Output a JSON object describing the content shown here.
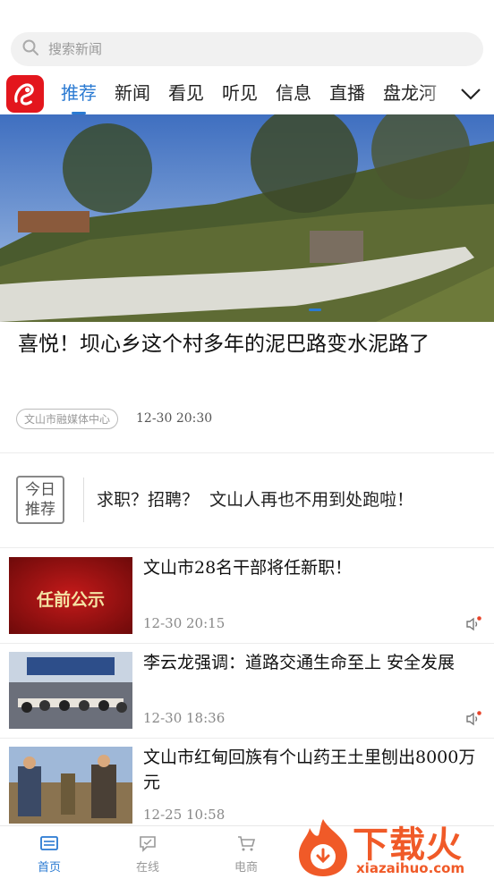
{
  "search": {
    "placeholder": "搜索新闻"
  },
  "tabs": [
    {
      "label": "推荐",
      "active": true
    },
    {
      "label": "新闻"
    },
    {
      "label": "看见"
    },
    {
      "label": "听见"
    },
    {
      "label": "信息"
    },
    {
      "label": "直播"
    },
    {
      "label": "盘龙河"
    }
  ],
  "banner": {
    "headline": "喜悦！坝心乡这个村多年的泥巴路变水泥路了",
    "source": "文山市融媒体中心",
    "time": "12-30 20:30"
  },
  "today": {
    "badge_line1": "今日",
    "badge_line2": "推荐",
    "text": "求职？招聘？  文山人再也不用到处跑啦！"
  },
  "news": [
    {
      "title": "文山市28名干部将任新职！",
      "time": "12-30 20:15",
      "thumb_text": "任前公示"
    },
    {
      "title": "李云龙强调：道路交通生命至上 安全发展",
      "time": "12-30 18:36"
    },
    {
      "title": "文山市红甸回族有个山药王土里刨出8000万元",
      "time": "12-25 10:58"
    }
  ],
  "bottom_nav": [
    {
      "label": "首页",
      "icon": "news-icon",
      "active": true
    },
    {
      "label": "在线",
      "icon": "chat-icon"
    },
    {
      "label": "电商",
      "icon": "cart-icon"
    }
  ],
  "watermark": {
    "text": "下载火",
    "url": "xiazaihuo.com"
  },
  "colors": {
    "accent": "#2a7ad2",
    "brand_red": "#e3161d",
    "watermark": "#f05a28"
  }
}
